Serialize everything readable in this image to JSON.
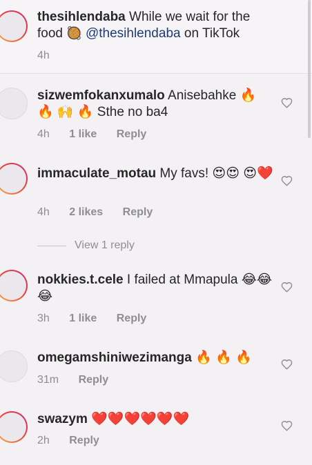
{
  "caption": {
    "username": "thesihlendaba",
    "text_a": "While we wait for the food",
    "emoji": "🥘",
    "mention": "@thesihlendaba",
    "text_b": "on TikTok",
    "time": "4h"
  },
  "comments": [
    {
      "username": "sizwemfokanxumalo",
      "text": "Anisebahke 🔥 🔥 🙌 🔥 Sthe no ba4",
      "time": "4h",
      "likes": "1 like",
      "reply": "Reply"
    },
    {
      "username": "immaculate_motau",
      "text": "My favs! 😍😍 😍❤️",
      "time": "4h",
      "likes": "2 likes",
      "reply": "Reply",
      "view_replies": "View 1 reply"
    },
    {
      "username": "nokkies.t.cele",
      "text": "I failed at Mmapula 😂😂😂",
      "time": "3h",
      "likes": "1 like",
      "reply": "Reply"
    },
    {
      "username": "omegamshiniwezimanga",
      "text": "🔥 🔥 🔥",
      "time": "31m",
      "reply": "Reply"
    },
    {
      "username": "swazym",
      "text": "❤️❤️❤️❤️❤️❤️",
      "time": "2h",
      "reply": "Reply"
    }
  ],
  "colors": {
    "background": "#f3f1f4",
    "text": "#262626",
    "meta": "#8e8e8e",
    "mention": "#1e3c72",
    "story_ring": "#e9443c"
  },
  "icons": {
    "like": "heart-outline-icon"
  }
}
